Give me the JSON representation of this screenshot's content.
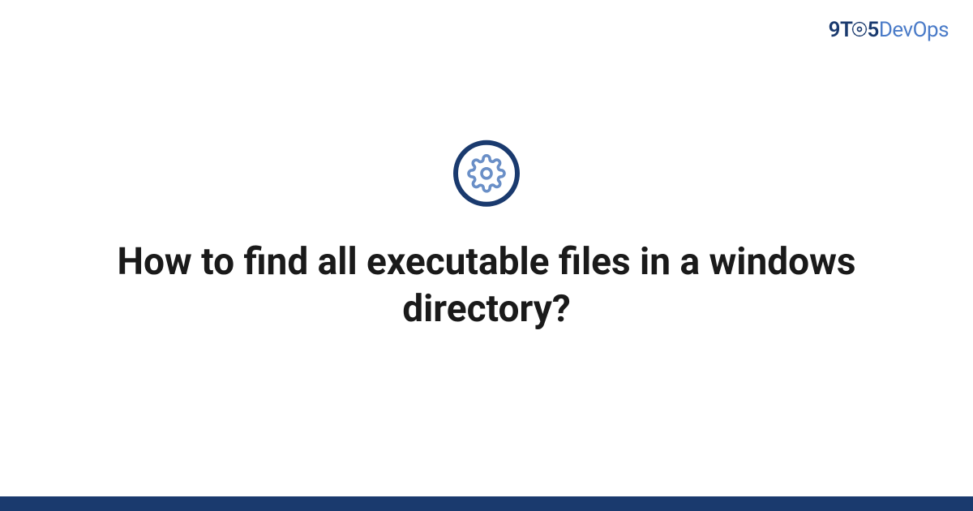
{
  "logo": {
    "part1": "9",
    "part2": "T",
    "part3": "5",
    "part4": "DevOps"
  },
  "title": "How to find all executable files in a windows directory?",
  "colors": {
    "primary": "#1a3a6e",
    "accent": "#4a7bc8"
  }
}
